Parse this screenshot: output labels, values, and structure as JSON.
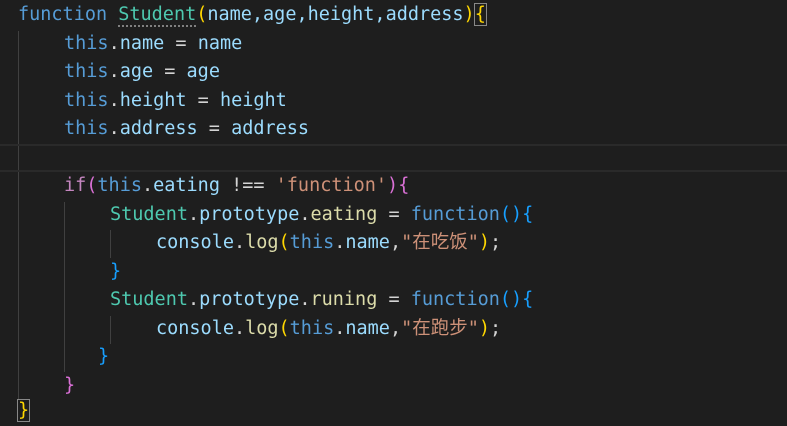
{
  "code_lines": [
    [
      "function",
      " ",
      "Student",
      "(",
      "name,age,height,address",
      ")",
      "{"
    ],
    [
      "this",
      ".",
      "name",
      " = ",
      "name"
    ],
    [
      "this",
      ".",
      "age",
      " = ",
      "age"
    ],
    [
      "this",
      ".",
      "height",
      " = ",
      "height"
    ],
    [
      "this",
      ".",
      "address",
      " = ",
      "address"
    ],
    [
      ""
    ],
    [
      "if",
      "(",
      "this",
      ".",
      "eating",
      " !== ",
      "'function'",
      ")",
      "{"
    ],
    [
      "Student",
      ".",
      "prototype",
      ".",
      "eating",
      " = ",
      "function",
      "()",
      "{"
    ],
    [
      "console",
      ".",
      "log",
      "(",
      "this",
      ".",
      "name",
      ",",
      "\"在吃饭\"",
      ")",
      ";"
    ],
    [
      "}"
    ],
    [
      "Student",
      ".",
      "prototype",
      ".",
      "runing",
      " = ",
      "function",
      "()",
      "{"
    ],
    [
      "console",
      ".",
      "log",
      "(",
      "this",
      ".",
      "name",
      ",",
      "\"在跑步\"",
      ")",
      ";"
    ],
    [
      "}"
    ],
    [
      "}"
    ],
    [
      "}"
    ]
  ],
  "colors": {
    "background": "#1e1e1e",
    "keyword": "#569cd6",
    "control": "#c586c0",
    "variable": "#9cdcfe",
    "class": "#4ec9b0",
    "function": "#dcdcaa",
    "string": "#ce9178",
    "bracket_level_1": "#ffd700",
    "bracket_level_2": "#da70d6",
    "bracket_level_3": "#179fff"
  }
}
